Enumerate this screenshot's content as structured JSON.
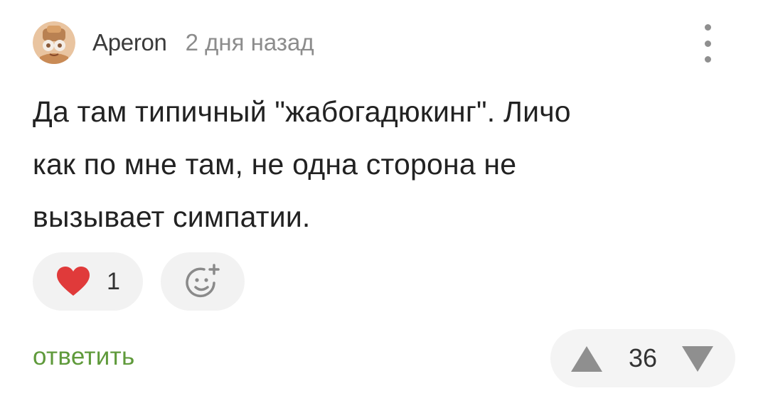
{
  "comment": {
    "author": "Aperon",
    "timestamp": "2 дня назад",
    "avatar_icon": "avatar-cartoon-knight-icon",
    "text_lines": [
      "Да там типичный \"жабогадюкинг\". Личо",
      "как по мне там, не одна сторона не",
      "вызывает симпатии."
    ]
  },
  "reactions": {
    "like_icon": "heart-icon",
    "like_count": "1",
    "like_color": "#e03a3a",
    "add_reaction_icon": "add-emoji-icon"
  },
  "actions": {
    "reply_label": "ответить",
    "reply_color": "#5f9a3b",
    "menu_icon": "more-vertical-icon"
  },
  "votes": {
    "up_icon": "triangle-up-icon",
    "down_icon": "triangle-down-icon",
    "score": "36"
  }
}
